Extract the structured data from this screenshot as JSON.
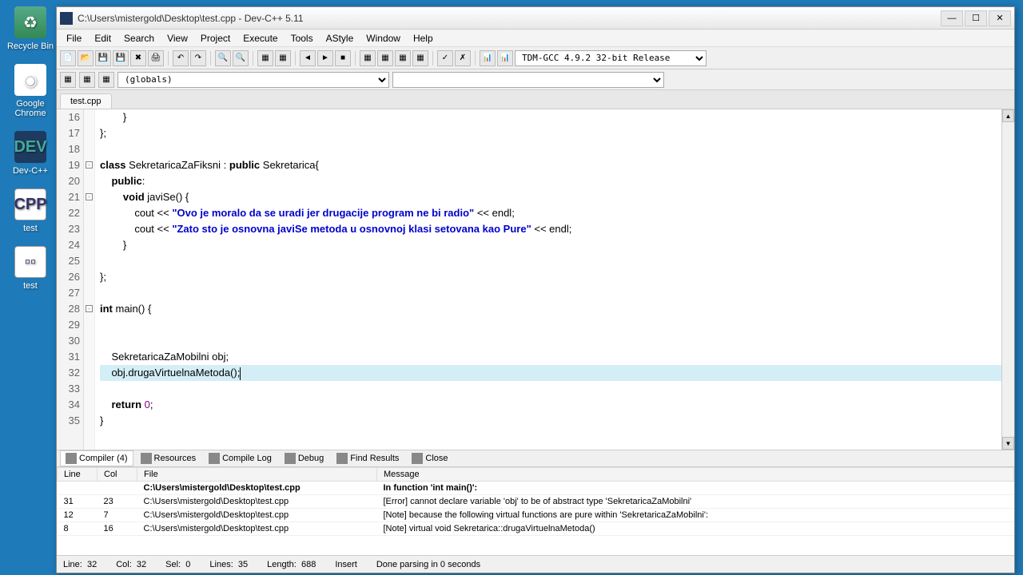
{
  "desktop": {
    "icons": [
      {
        "label": "Recycle Bin"
      },
      {
        "label": "Google Chrome"
      },
      {
        "label": "Dev-C++"
      },
      {
        "label": "test"
      },
      {
        "label": "test"
      }
    ]
  },
  "window": {
    "title": "C:\\Users\\mistergold\\Desktop\\test.cpp - Dev-C++ 5.11"
  },
  "menu": {
    "items": [
      "File",
      "Edit",
      "Search",
      "View",
      "Project",
      "Execute",
      "Tools",
      "AStyle",
      "Window",
      "Help"
    ]
  },
  "toolbar": {
    "compiler_select": "TDM-GCC 4.9.2 32-bit Release"
  },
  "scope": {
    "globals": "(globals)"
  },
  "tabs": {
    "file": "test.cpp"
  },
  "code": {
    "lines": [
      {
        "n": 16,
        "html": "        }"
      },
      {
        "n": 17,
        "html": "};"
      },
      {
        "n": 18,
        "html": ""
      },
      {
        "n": 19,
        "html": "<span class='kw'>class</span> SekretaricaZaFiksni : <span class='kw'>public</span> Sekretarica{"
      },
      {
        "n": 20,
        "html": "    <span class='kw'>public</span>:"
      },
      {
        "n": 21,
        "html": "        <span class='kw'>void</span> javiSe() {"
      },
      {
        "n": 22,
        "html": "            cout << <span class='str'>\"Ovo je moralo da se uradi jer drugacije program ne bi radio\"</span> << endl;"
      },
      {
        "n": 23,
        "html": "            cout << <span class='str'>\"Zato sto je osnovna javiSe metoda u osnovnoj klasi setovana kao Pure\"</span> << endl;"
      },
      {
        "n": 24,
        "html": "        }"
      },
      {
        "n": 25,
        "html": ""
      },
      {
        "n": 26,
        "html": "};"
      },
      {
        "n": 27,
        "html": ""
      },
      {
        "n": 28,
        "html": "<span class='kw'>int</span> main() {"
      },
      {
        "n": 29,
        "html": ""
      },
      {
        "n": 30,
        "html": "    "
      },
      {
        "n": 31,
        "html": "    SekretaricaZaMobilni obj;"
      },
      {
        "n": 32,
        "html": "    obj.drugaVirtuelnaMetoda();",
        "highlight": true,
        "cursor": true
      },
      {
        "n": 33,
        "html": "    "
      },
      {
        "n": 34,
        "html": "    <span class='kw'>return</span> <span class='num'>0</span>;"
      },
      {
        "n": 35,
        "html": "}"
      }
    ]
  },
  "bottom_tabs": {
    "items": [
      {
        "label": "Compiler (4)",
        "active": true
      },
      {
        "label": "Resources"
      },
      {
        "label": "Compile Log"
      },
      {
        "label": "Debug"
      },
      {
        "label": "Find Results"
      },
      {
        "label": "Close"
      }
    ]
  },
  "compiler": {
    "headers": [
      "Line",
      "Col",
      "File",
      "Message"
    ],
    "rows": [
      {
        "line": "",
        "col": "",
        "file": "C:\\Users\\mistergold\\Desktop\\test.cpp",
        "msg": "In function 'int main()':",
        "bold": true
      },
      {
        "line": "31",
        "col": "23",
        "file": "C:\\Users\\mistergold\\Desktop\\test.cpp",
        "msg": "[Error] cannot declare variable 'obj' to be of abstract type 'SekretaricaZaMobilni'"
      },
      {
        "line": "12",
        "col": "7",
        "file": "C:\\Users\\mistergold\\Desktop\\test.cpp",
        "msg": "[Note] because the following virtual functions are pure within 'SekretaricaZaMobilni':"
      },
      {
        "line": "8",
        "col": "16",
        "file": "C:\\Users\\mistergold\\Desktop\\test.cpp",
        "msg": "[Note] virtual void Sekretarica::drugaVirtuelnaMetoda()"
      }
    ]
  },
  "status": {
    "line_lbl": "Line:",
    "line_val": "32",
    "col_lbl": "Col:",
    "col_val": "32",
    "sel_lbl": "Sel:",
    "sel_val": "0",
    "lines_lbl": "Lines:",
    "lines_val": "35",
    "length_lbl": "Length:",
    "length_val": "688",
    "mode": "Insert",
    "parse": "Done parsing in 0 seconds"
  }
}
